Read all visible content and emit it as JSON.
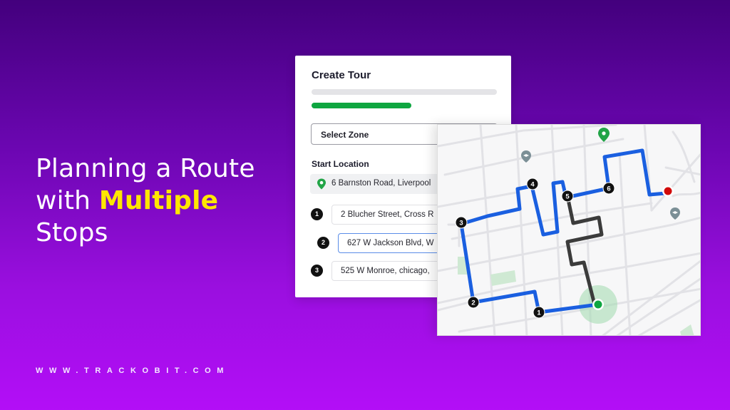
{
  "hero": {
    "line1": "Planning a Route",
    "line2_prefix": "with ",
    "line2_accent": "Multiple",
    "line3": "Stops",
    "accent_color": "#ffe600"
  },
  "footer": {
    "website": "WWW.TRACKOBIT.COM"
  },
  "form": {
    "title": "Create Tour",
    "progress_percent": 54,
    "progress_color": "#0ea640",
    "zone_select": {
      "label": "Select Zone"
    },
    "start_location": {
      "label": "Start Location",
      "value": "6 Barnston Road, Liverpool",
      "icon": "location-pin-icon"
    },
    "stops": [
      {
        "number": "1",
        "value": "2 Blucher Street, Cross R",
        "active": false
      },
      {
        "number": "2",
        "value": "627 W Jackson Blvd, W",
        "active": true
      },
      {
        "number": "3",
        "value": "525 W Monroe, chicago,",
        "active": false
      }
    ]
  },
  "map": {
    "route_color": "#1a5fe0",
    "alt_route_color": "#3b3b3b",
    "start_color": "#0ea640",
    "end_color": "#d10a0a",
    "markers": [
      "1",
      "2",
      "3",
      "4",
      "5",
      "6"
    ],
    "pois": [
      "green-location-pin",
      "school-pin",
      "school-pin"
    ]
  }
}
